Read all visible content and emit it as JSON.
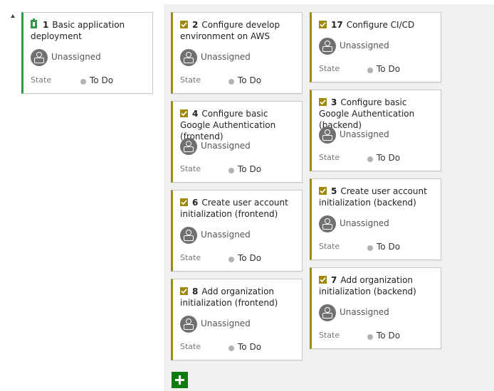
{
  "parent": {
    "id": "1",
    "title": "Basic application deployment",
    "assignee": "Unassigned",
    "state_label": "State",
    "state": "To Do"
  },
  "tasks_col1": [
    {
      "id": "2",
      "title": "Configure develop environment on AWS",
      "assignee": "Unassigned",
      "state_label": "State",
      "state": "To Do"
    },
    {
      "id": "4",
      "title": "Configure basic Google Authentication (frontend)",
      "assignee": "Unassigned",
      "state_label": "State",
      "state": "To Do"
    },
    {
      "id": "6",
      "title": "Create user account initialization (frontend)",
      "assignee": "Unassigned",
      "state_label": "State",
      "state": "To Do"
    },
    {
      "id": "8",
      "title": "Add organization initialization (frontend)",
      "assignee": "Unassigned",
      "state_label": "State",
      "state": "To Do"
    }
  ],
  "tasks_col2": [
    {
      "id": "17",
      "title": "Configure CI/CD",
      "assignee": "Unassigned",
      "state_label": "State",
      "state": "To Do"
    },
    {
      "id": "3",
      "title": "Configure basic Google Authentication (backend)",
      "assignee": "Unassigned",
      "state_label": "State",
      "state": "To Do"
    },
    {
      "id": "5",
      "title": "Create user account initialization (backend)",
      "assignee": "Unassigned",
      "state_label": "State",
      "state": "To Do"
    },
    {
      "id": "7",
      "title": "Add organization initialization (backend)",
      "assignee": "Unassigned",
      "state_label": "State",
      "state": "To Do"
    }
  ],
  "icons": {
    "parent_type": "product-backlog-item-icon",
    "task_type": "task-checkbox-icon",
    "avatar": "user-avatar-icon",
    "add": "plus-icon"
  },
  "colors": {
    "task_accent": "#a0880a",
    "pbi_accent": "#339947",
    "add_button": "#107c10",
    "state_todo": "#b2b2b2"
  }
}
